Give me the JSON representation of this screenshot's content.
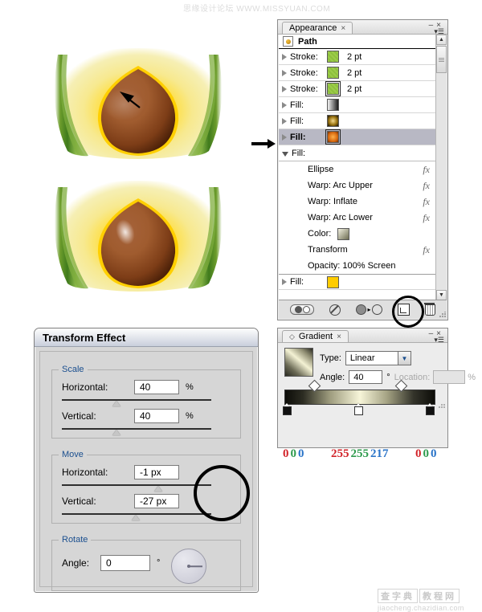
{
  "watermarks": {
    "top": "思缘设计论坛  WWW.MISSYUAN.COM",
    "bottom_box1": "查字典",
    "bottom_box2": "教程网",
    "bottom_url": "jiaocheng.chazidian.com"
  },
  "artwork": {
    "top_image_name": "avocado-half-with-arrow",
    "bottom_image_name": "avocado-half-with-highlight",
    "arrow_label": "black-arrow-annotation"
  },
  "appearance": {
    "tab_label": "Appearance",
    "tab_close": "×",
    "minimize": "–",
    "close": "×",
    "menu_icon": "panel-menu-icon",
    "target_label": "Path",
    "rows": [
      {
        "disclosure": "closed",
        "label": "Stroke:",
        "value": "2 pt",
        "swatch": "green-swatch",
        "selected": false,
        "outlined": false
      },
      {
        "disclosure": "closed",
        "label": "Stroke:",
        "value": "2 pt",
        "swatch": "green-swatch",
        "selected": false,
        "outlined": false
      },
      {
        "disclosure": "closed",
        "label": "Stroke:",
        "value": "2 pt",
        "swatch": "green-swatch",
        "selected": false,
        "outlined": true
      },
      {
        "disclosure": "closed",
        "label": "Fill:",
        "value": "",
        "swatch": "grey-gradient-swatch",
        "selected": false,
        "outlined": false
      },
      {
        "disclosure": "closed",
        "label": "Fill:",
        "value": "",
        "swatch": "dark-gold-radial-swatch",
        "selected": false,
        "outlined": false
      },
      {
        "disclosure": "closed",
        "label": "Fill:",
        "value": "",
        "swatch": "orange-radial-swatch",
        "selected": true,
        "outlined": true
      },
      {
        "disclosure": "open",
        "label": "Fill:",
        "value": "",
        "swatch": "none",
        "selected": false,
        "outlined": false
      }
    ],
    "sub_items": [
      {
        "label": "Ellipse",
        "fx": "fx",
        "swatch": null
      },
      {
        "label": "Warp: Arc Upper",
        "fx": "fx",
        "swatch": null
      },
      {
        "label": "Warp: Inflate",
        "fx": "fx",
        "swatch": null
      },
      {
        "label": "Warp: Arc Lower",
        "fx": "fx",
        "swatch": null
      },
      {
        "label": "Color:",
        "fx": "",
        "swatch": "olive-gradient-swatch"
      },
      {
        "label": "Transform",
        "fx": "fx",
        "swatch": null
      },
      {
        "label": "Opacity: 100% Screen",
        "fx": "",
        "swatch": null
      }
    ],
    "last_row": {
      "disclosure": "closed",
      "label": "Fill:",
      "value": "",
      "swatch": "yellow-swatch"
    },
    "toolbar": {
      "new_art_label": "new-art-has-basic-appearance-icon",
      "clear_label": "clear-appearance-icon",
      "reduce_label": "reduce-to-basic-appearance-icon",
      "duplicate_label": "duplicate-selected-item-icon",
      "delete_label": "delete-selected-item-icon"
    },
    "scrollbar": {
      "up": "▲",
      "down": "▼"
    }
  },
  "transform_effect": {
    "title": "Transform Effect",
    "scale": {
      "legend": "Scale",
      "horizontal_label": "Horizontal:",
      "horizontal_value": "40",
      "horizontal_unit": "%",
      "vertical_label": "Vertical:",
      "vertical_value": "40",
      "vertical_unit": "%"
    },
    "move": {
      "legend": "Move",
      "horizontal_label": "Horizontal:",
      "horizontal_value": "-1 px",
      "vertical_label": "Vertical:",
      "vertical_value": "-27 px"
    },
    "rotate": {
      "legend": "Rotate",
      "angle_label": "Angle:",
      "angle_value": "0",
      "angle_unit": "°",
      "dial_name": "rotate-dial"
    }
  },
  "gradient": {
    "tab_label": "Gradient",
    "tab_close": "×",
    "minimize": "–",
    "close": "×",
    "type_label": "Type:",
    "type_value": "Linear",
    "angle_label": "Angle:",
    "angle_value": "40",
    "angle_unit": "°",
    "location_label": "Location:",
    "location_value": "",
    "location_unit": "%",
    "stops": [
      {
        "position": 0,
        "r": "0",
        "g": "0",
        "b": "0"
      },
      {
        "position": 50,
        "r": "255",
        "g": "255",
        "b": "217"
      },
      {
        "position": 100,
        "r": "0",
        "g": "0",
        "b": "0"
      }
    ],
    "midpoints": [
      25,
      75
    ],
    "colors": {
      "accent_red": "#d2242a",
      "accent_green": "#2f9b4e",
      "accent_blue": "#2a74c8"
    }
  }
}
